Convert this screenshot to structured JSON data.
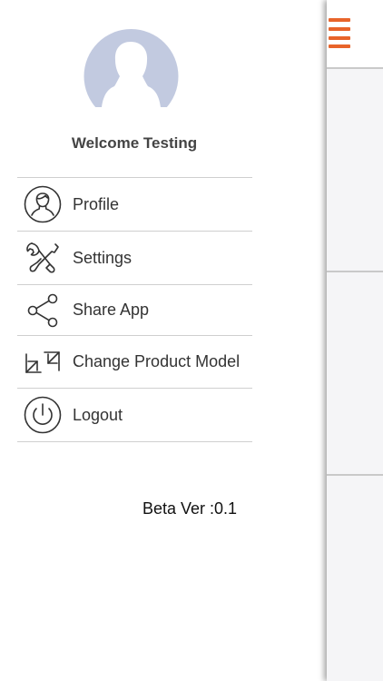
{
  "drawer": {
    "welcome_text": "Welcome Testing",
    "avatar_icon": "user-silhouette-icon",
    "menu": [
      {
        "label": "Profile",
        "icon": "profile-icon"
      },
      {
        "label": "Settings",
        "icon": "tools-icon"
      },
      {
        "label": "Share App",
        "icon": "share-icon"
      },
      {
        "label": "Change Product Model",
        "icon": "swap-arrows-icon"
      },
      {
        "label": "Logout",
        "icon": "power-icon"
      }
    ],
    "version_text": "Beta Ver :0.1"
  },
  "main": {
    "menu_icon": "hamburger-icon"
  },
  "colors": {
    "accent": "#e8642a",
    "avatar_bg": "#c2cae0",
    "divider": "#cfcfcf"
  }
}
